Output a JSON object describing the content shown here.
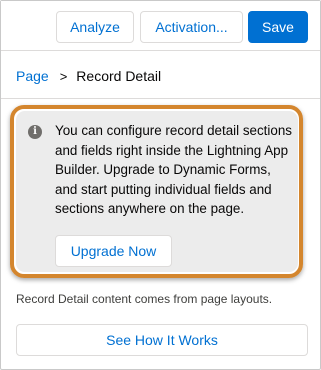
{
  "toolbar": {
    "analyze_label": "Analyze",
    "activation_label": "Activation...",
    "save_label": "Save"
  },
  "breadcrumb": {
    "parent": "Page",
    "separator": ">",
    "current": "Record Detail"
  },
  "notice": {
    "icon": "info-icon",
    "icon_glyph": "i",
    "message": "You can configure record detail sections and fields right inside the Lightning App Builder. Upgrade to Dynamic Forms, and start putting individual fields and sections anywhere on the page.",
    "button_label": "Upgrade Now"
  },
  "help_text": "Record Detail content comes from page layouts.",
  "see_how_label": "See How It Works",
  "colors": {
    "brand": "#0070d2",
    "highlight_outline": "#d4862e",
    "notice_background": "#ececec"
  }
}
